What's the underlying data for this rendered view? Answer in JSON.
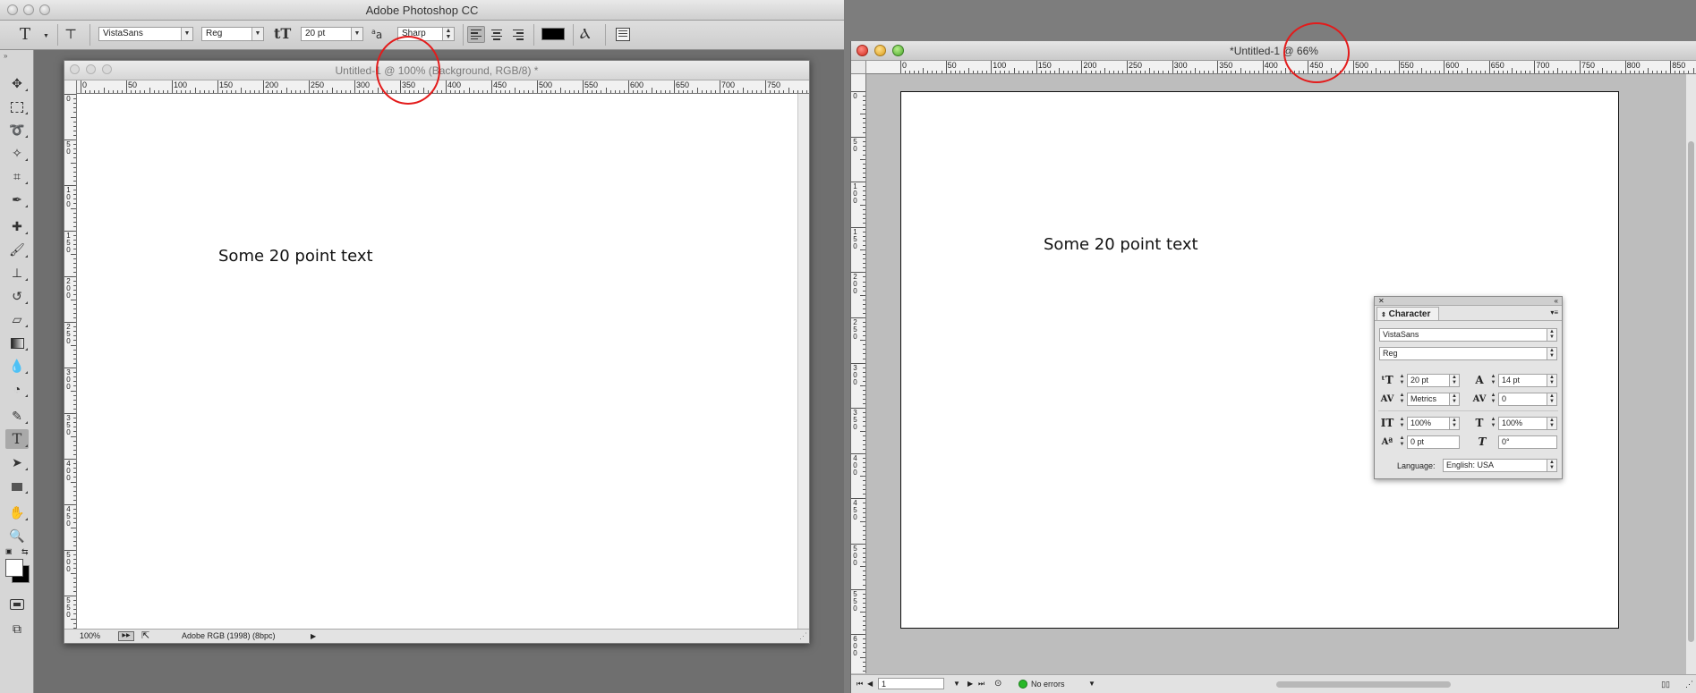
{
  "photoshop": {
    "app_title": "Adobe Photoshop CC",
    "options": {
      "font_family": "VistaSans",
      "font_style": "Reg",
      "font_size": "20 pt",
      "antialias": "Sharp",
      "text_color": "#000000"
    },
    "document": {
      "title": "Untitled-1 @ 100% (Background, RGB/8) *",
      "text": "Some 20 point text",
      "zoom": "100%",
      "profile": "Adobe RGB (1998) (8bpc)",
      "ruler_h": [
        "0",
        "50",
        "100",
        "150",
        "200",
        "250",
        "300",
        "350",
        "400",
        "450",
        "500",
        "550",
        "600",
        "650",
        "700",
        "750"
      ],
      "ruler_v": [
        "0",
        "50",
        "100",
        "150",
        "200",
        "250",
        "300",
        "350",
        "400",
        "450",
        "500",
        "550"
      ]
    }
  },
  "indesign": {
    "document": {
      "title": "*Untitled-1 @ 66%",
      "text": "Some 20 point text",
      "ruler_h": [
        "0",
        "50",
        "100",
        "150",
        "200",
        "250",
        "300",
        "350",
        "400",
        "450",
        "500",
        "550",
        "600",
        "650",
        "700",
        "750",
        "800",
        "850"
      ],
      "ruler_v": [
        "0",
        "50",
        "100",
        "150",
        "200",
        "250",
        "300",
        "350",
        "400",
        "450",
        "500",
        "550",
        "600"
      ],
      "status": {
        "page": "1",
        "preflight": "No errors"
      }
    },
    "character_panel": {
      "title": "Character",
      "font_family": "VistaSans",
      "font_style": "Reg",
      "size": "20 pt",
      "leading": "14 pt",
      "kerning": "Metrics",
      "tracking": "0",
      "vertical_scale": "100%",
      "horizontal_scale": "100%",
      "baseline_shift": "0 pt",
      "skew": "0°",
      "language_label": "Language:",
      "language": "English: USA"
    }
  }
}
